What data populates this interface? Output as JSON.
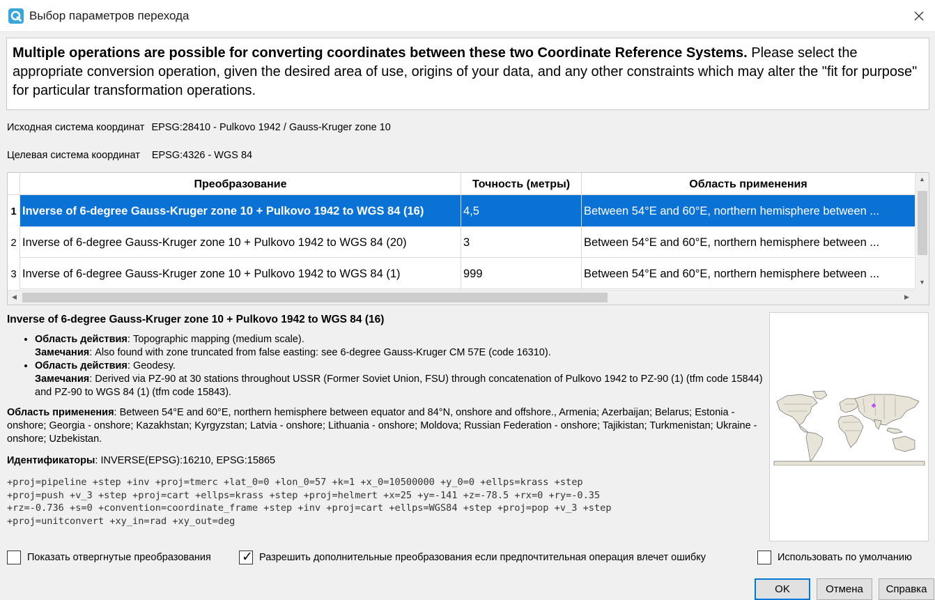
{
  "window": {
    "title": "Выбор параметров перехода",
    "app_icon": "qgis-icon",
    "close_icon": "close-icon"
  },
  "info": {
    "bold_text": "Multiple operations are possible for converting coordinates between these two Coordinate Reference Systems.",
    "normal_text": " Please select the appropriate conversion operation, given the desired area of use, origins of your data, and any other constraints which may alter the \"fit for purpose\" for particular transformation operations."
  },
  "source_crs": {
    "label": "Исходная система координат",
    "value": "EPSG:28410 - Pulkovo 1942 / Gauss-Kruger zone 10"
  },
  "target_crs": {
    "label": "Целевая система координат",
    "value": "EPSG:4326 - WGS 84"
  },
  "table": {
    "headers": [
      "Преобразование",
      "Точность (метры)",
      "Область применения"
    ],
    "rows": [
      {
        "num": "1",
        "transform": "Inverse of 6-degree Gauss-Kruger zone 10 + Pulkovo 1942 to WGS 84 (16)",
        "accuracy": "4,5",
        "area": "Between 54°E and 60°E, northern hemisphere between ...",
        "selected": true
      },
      {
        "num": "2",
        "transform": "Inverse of 6-degree Gauss-Kruger zone 10 + Pulkovo 1942 to WGS 84 (20)",
        "accuracy": "3",
        "area": "Between 54°E and 60°E, northern hemisphere between ...",
        "selected": false
      },
      {
        "num": "3",
        "transform": "Inverse of 6-degree Gauss-Kruger zone 10 + Pulkovo 1942 to WGS 84 (1)",
        "accuracy": "999",
        "area": "Between 54°E and 60°E, northern hemisphere between ...",
        "selected": false
      }
    ]
  },
  "details": {
    "title": "Inverse of 6-degree Gauss-Kruger zone 10 + Pulkovo 1942 to WGS 84 (16)",
    "scope_label": "Область действия",
    "remarks_label": "Замечания",
    "items": [
      {
        "scope": ": Topographic mapping (medium scale).",
        "remarks": ": Also found with zone truncated from false easting: see 6-degree Gauss-Kruger CM 57E (code 16310)."
      },
      {
        "scope": ": Geodesy.",
        "remarks": ": Derived via PZ-90 at 30 stations throughout USSR (Former Soviet Union, FSU) through concatenation of Pulkovo 1942 to PZ-90 (1) (tfm code 15844) and PZ-90 to WGS 84 (1) (tfm code 15843)."
      }
    ],
    "area_label": "Область применения",
    "area_text": ": Between 54°E and 60°E, northern hemisphere between equator and 84°N, onshore and offshore., Armenia; Azerbaijan; Belarus; Estonia - onshore; Georgia - onshore; Kazakhstan; Kyrgyzstan; Latvia - onshore; Lithuania - onshore; Moldova; Russian Federation - onshore; Tajikistan; Turkmenistan; Ukraine - onshore; Uzbekistan.",
    "ids_label": "Идентификаторы",
    "ids_text": ": INVERSE(EPSG):16210, EPSG:15865",
    "proj": "+proj=pipeline +step +inv +proj=tmerc +lat_0=0 +lon_0=57 +k=1 +x_0=10500000 +y_0=0 +ellps=krass +step\n+proj=push +v_3 +step +proj=cart +ellps=krass +step +proj=helmert +x=25 +y=-141 +z=-78.5 +rx=0 +ry=-0.35\n+rz=-0.736 +s=0 +convention=coordinate_frame +step +inv +proj=cart +ellps=WGS84 +step +proj=pop +v_3 +step\n+proj=unitconvert +xy_in=rad +xy_out=deg"
  },
  "map": {
    "icon": "world-map-icon",
    "marker_color": "#c040ff",
    "land_color": "#e8e4d8"
  },
  "checkboxes": [
    {
      "label": "Показать отвергнутые преобразования",
      "checked": false
    },
    {
      "label": "Разрешить дополнительные преобразования если предпочтительная операция влечет ошибку",
      "checked": true
    },
    {
      "label": "Использовать по умолчанию",
      "checked": false
    }
  ],
  "buttons": {
    "ok": "OK",
    "cancel": "Отмена",
    "help": "Справка"
  },
  "colors": {
    "selection": "#0a72d4",
    "default_button_border": "#0078d7"
  }
}
